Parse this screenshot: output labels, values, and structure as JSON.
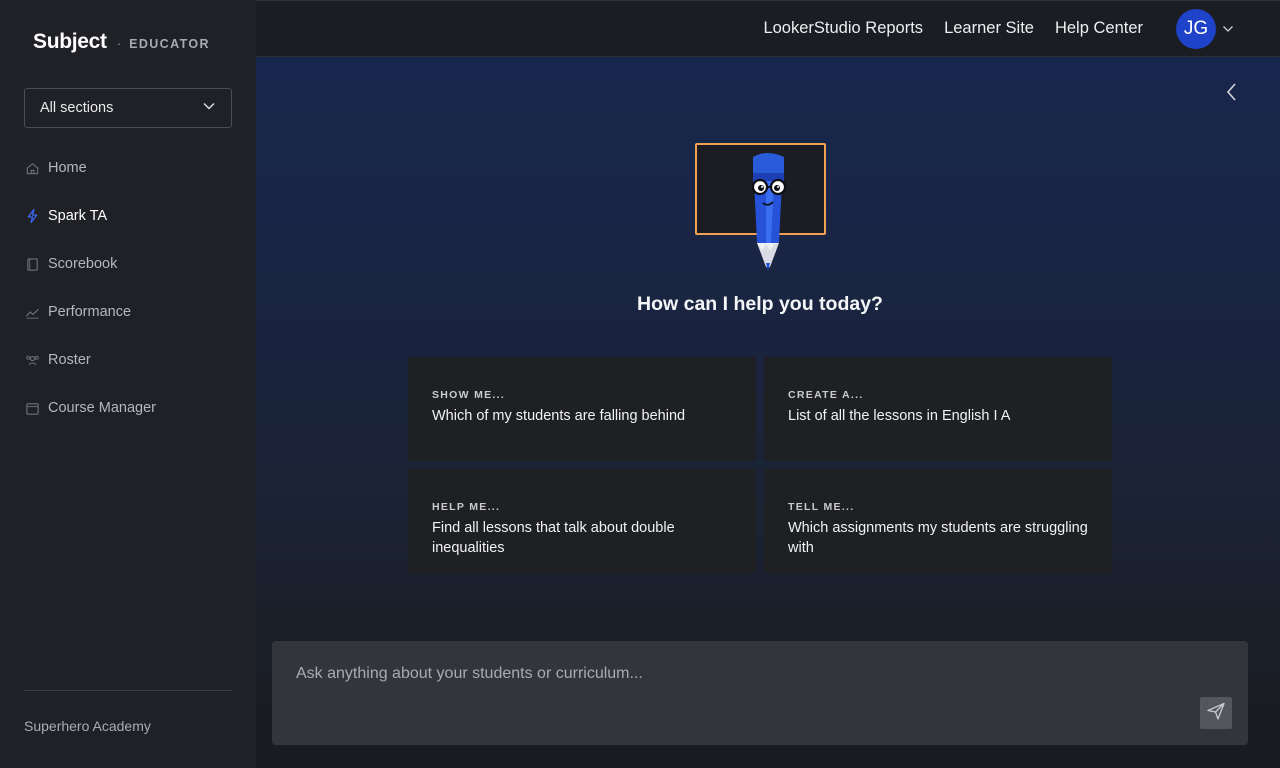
{
  "brand": {
    "name": "Subject",
    "separator": "·",
    "role": "EDUCATOR"
  },
  "section_select": {
    "value": "All sections"
  },
  "nav": {
    "items": [
      {
        "label": "Home",
        "icon": "home-icon",
        "active": false
      },
      {
        "label": "Spark TA",
        "icon": "lightning-icon",
        "active": true
      },
      {
        "label": "Scorebook",
        "icon": "book-icon",
        "active": false
      },
      {
        "label": "Performance",
        "icon": "chart-line-icon",
        "active": false
      },
      {
        "label": "Roster",
        "icon": "users-icon",
        "active": false
      },
      {
        "label": "Course Manager",
        "icon": "calendar-icon",
        "active": false
      }
    ]
  },
  "org": {
    "name": "Superhero Academy"
  },
  "topbar": {
    "links": [
      "LookerStudio Reports",
      "Learner Site",
      "Help Center"
    ],
    "avatar_initials": "JG"
  },
  "main": {
    "greeting": "How can I help you today?",
    "cards": [
      {
        "kicker": "SHOW ME...",
        "prompt": "Which of my students are falling behind"
      },
      {
        "kicker": "CREATE A...",
        "prompt": "List of all the lessons in English I A"
      },
      {
        "kicker": "HELP ME...",
        "prompt": "Find all lessons that talk about double inequalities"
      },
      {
        "kicker": "TELL ME...",
        "prompt": "Which assignments my students are struggling with"
      }
    ],
    "composer": {
      "placeholder": "Ask anything about your students or curriculum...",
      "value": ""
    }
  },
  "colors": {
    "accent": "#1e43c8",
    "active_icon": "#3d6bff",
    "frame": "#f0a153"
  }
}
